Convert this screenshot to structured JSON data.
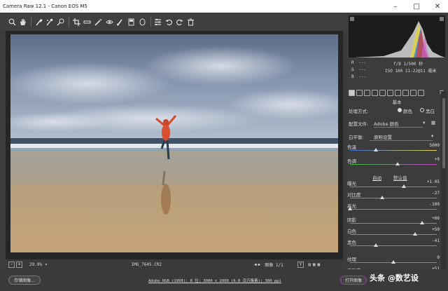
{
  "window": {
    "title": "Camera Raw 12.1 - Canon EOS M5"
  },
  "toolbar": {
    "tools": [
      "zoom-icon",
      "hand-icon",
      "white-balance-icon",
      "color-sampler-icon",
      "targeted-adjust-icon",
      "crop-icon",
      "straighten-icon",
      "spot-removal-icon",
      "red-eye-icon",
      "adjustment-brush-icon",
      "graduated-filter-icon",
      "radial-filter-icon",
      "preferences-icon",
      "rotate-left-icon",
      "rotate-right-icon",
      "trash-icon"
    ],
    "fullscreen": "fullscreen-icon"
  },
  "info": {
    "r_label": "R",
    "g_label": "G",
    "b_label": "B",
    "r_val": "---",
    "g_val": "---",
    "b_val": "---",
    "aperture_shutter": "f/8   1/500 秒",
    "iso_focal": "ISO 100   11-22@11 毫米"
  },
  "panel": {
    "title": "基本",
    "treatment_label": "处理方式:",
    "treatment_color": "颜色",
    "treatment_bw": "黑白",
    "profile_label": "配置文件:",
    "profile_value": "Adobe 颜色",
    "wb_label": "白平衡:",
    "wb_value": "原照设置",
    "auto": "自动",
    "default": "默认值",
    "sliders": [
      {
        "name": "temp",
        "label": "色温",
        "value": "5000",
        "pos": 0.3
      },
      {
        "name": "tint",
        "label": "色调",
        "value": "+9",
        "pos": 0.55
      },
      {
        "name": "exposure",
        "label": "曝光",
        "value": "+1.05",
        "pos": 0.62
      },
      {
        "name": "contrast",
        "label": "对比度",
        "value": "-27",
        "pos": 0.37
      },
      {
        "name": "highlights",
        "label": "高光",
        "value": "-100",
        "pos": 0.0
      },
      {
        "name": "shadows",
        "label": "阴影",
        "value": "+66",
        "pos": 0.83
      },
      {
        "name": "whites",
        "label": "白色",
        "value": "+50",
        "pos": 0.75
      },
      {
        "name": "blacks",
        "label": "黑色",
        "value": "-41",
        "pos": 0.3
      },
      {
        "name": "texture",
        "label": "纹理",
        "value": "0",
        "pos": 0.5
      },
      {
        "name": "clarity",
        "label": "清晰度",
        "value": "+51",
        "pos": 0.76
      }
    ]
  },
  "status": {
    "zoom": "29.9%",
    "filename": "IMG_7645.CR2",
    "image_label": "图像 1/1",
    "y_label": "Y"
  },
  "bottom": {
    "save_label": "存储图像...",
    "workflow_link": "Adobe RGB (1998); 8 位; 3000 x 2000 (6.0 百万像素); 300 ppi",
    "open_label": "打开图像",
    "watermark": "头条 @数艺设"
  }
}
